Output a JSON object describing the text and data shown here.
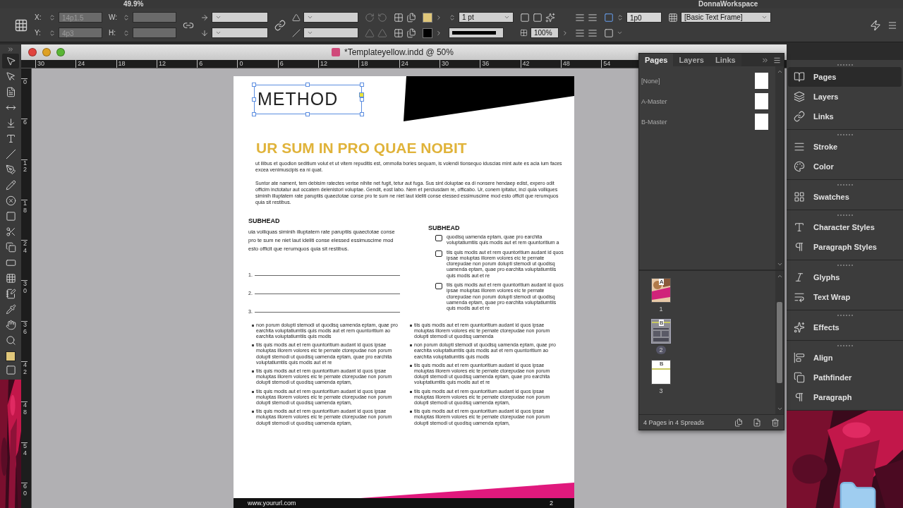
{
  "top_strip": {
    "zoom": "49.9%",
    "workspace": "DonnaWorkspace"
  },
  "control_bar": {
    "fields": [
      {
        "label": "X:",
        "value": "14p1.5",
        "disabled": true
      },
      {
        "label": "Y:",
        "value": "4p3",
        "disabled": true
      },
      {
        "label": "W:",
        "disabled": true
      },
      {
        "label": "H:",
        "disabled": true
      }
    ],
    "stroke_weight": "1 pt",
    "opacity": "100%",
    "frame_inset": "1p0",
    "object_style": "[Basic Text Frame]"
  },
  "toolbar": {
    "tools": [
      {
        "selected": true
      },
      {
        "selected": false
      },
      {
        "selected": false
      },
      {
        "selected": false
      },
      {
        "selected": false
      },
      {
        "selected": false
      },
      {
        "selected": false
      },
      {
        "selected": false
      },
      {
        "selected": false
      },
      {
        "selected": false
      },
      {
        "selected": false
      },
      {
        "selected": false
      },
      {
        "selected": false
      },
      {
        "selected": false
      },
      {
        "selected": false
      },
      {
        "selected": false
      },
      {
        "selected": false
      },
      {
        "selected": false
      },
      {
        "selected": false
      }
    ]
  },
  "document": {
    "title": "*Templateyellow.indd @ 50%",
    "h_ruler": [
      "30",
      "24",
      "18",
      "12",
      "6",
      "0",
      "6",
      "12",
      "18",
      "24",
      "30",
      "36",
      "42",
      "48",
      "54"
    ],
    "v_ruler": [
      "0",
      "6",
      "12",
      "18",
      "24",
      "30",
      "36",
      "42",
      "48",
      "54",
      "60"
    ],
    "page": {
      "heading": {
        "text": "METHOD",
        "selected": true
      },
      "title": "UR SUM IN PRO QUAE NOBIT",
      "paragraphs": [
        "ut ilibus et quodion seditium volut et ut vitem repuditis est, ommolla bories sequam, is volendi tionsequo iduscias mint aute es acia ium faces excea venimuscipis ea ni quat.",
        "Suntor ate nament, tem debisim ratectes verise nihite net fugit, tetur aut fuga. Sus sint doluptae ea di nonsere hendaep edist, expero odit officim inctotatur aut occatem delenistori voluptae. Gendit, eost labo. Nem et perciusdam re, officabo. Ur, conem ipitatur, inci quia volliques siminih illuptatem rate paruptiis quaectotae conse pro te sum ne niet laut ideliti conse elessed essimuscime mod esto officit que rerumquos quia sit restibus."
      ],
      "left_column": {
        "subhead": "SUBHEAD",
        "text": "uia volliquas siminih illuptatem rate paruptiis quaectotae conse pro te sum ne niet laut ideliti conse elessed essimuscime mod esto officit que rerumquos quia sit restibus.",
        "lines": [
          "1.",
          "2.",
          "3."
        ]
      },
      "right_column": {
        "subhead": "SUBHEAD",
        "checklist": [
          {
            "text": "quodisq uamenda eptam, quae pro earchita voluptatiumtiis quis modis aut et rem quuntoritium a",
            "checked": false
          },
          {
            "text": "tiis quis modis aut et rem quuntoritium audant id quos ipsae moluptas illorem volores eic te pernate ctorepudae non porum dolupti stemodi ut quodisq uamenda eptam, quae pro earchita voluptatiumtiis quis modis aut et re",
            "checked": false
          },
          {
            "text": "tiis quis modis aut et rem quuntoritium audant id quos ipsae moluptas illorem volores eic te pernate ctorepudae non porum dolupti stemodi ut quodisq uamenda eptam, quae pro earchita voluptatiumtiis quis modis aut et re",
            "checked": false
          }
        ]
      },
      "bullets_left": [
        "non porum dolupti stemodi ut quodisq uamenda eptam, quae pro earchita voluptatiumtiis quis modis aut et rem quuntoritium ao earchita voluptatiumtiis quis modis",
        "tiis quis modis aut et rem quuntoritium audant id quos ipsae moluptas illorem volores eic te pernate ctorepudae non porum dolupti stemodi ut quodisq uamenda eptam, quae pro earchita voluptatiumtiis quis modis aut et re",
        "tiis quis modis aut et rem quuntoritium audant id quos ipsae moluptas illorem volores eic te pernate ctorepudae non porum dolupti stemodi ut quodisq uamenda eptam,",
        "tiis quis modis aut et rem quuntoritium audant id quos ipsae moluptas illorem volores eic te pernate ctorepudae non porum dolupti stemodi ut quodisq uamenda eptam,",
        "tiis quis modis aut et rem quuntoritium audant id quos ipsae moluptas illorem volores eic te pernate ctorepudae non porum dolupti stemodi ut quodisq uamenda eptam,"
      ],
      "bullets_right": [
        "tiis quis modis aut et rem quuntoritium audant id quos ipsae moluptas illorem volores eic te pernate ctorepudae non porum dolupti stemodi ut quodisq uamenda",
        "non porum dolupti stemodi ut quodisq uamenda eptam, quae pro earchita voluptatiumtiis quis modis aut et rem quuntoritium ao earchita voluptatiumtiis quis modis",
        "tiis quis modis aut et rem quuntoritium audant id quos ipsae moluptas illorem volores eic te pernate ctorepudae non porum dolupti stemodi ut quodisq uamenda eptam, quae pro earchita voluptatiumtiis quis modis aut et re",
        "tiis quis modis aut et rem quuntoritium audant id quos ipsae moluptas illorem volores eic te pernate ctorepudae non porum dolupti stemodi ut quodisq uamenda eptam,",
        "tiis quis modis aut et rem quuntoritium audant id quos ipsae moluptas illorem volores eic te pernate ctorepudae non porum dolupti stemodi ut quodisq uamenda eptam,"
      ],
      "footer": {
        "url": "www.yoururl.com",
        "page_number": "2"
      }
    }
  },
  "pages_panel": {
    "tabs": [
      {
        "label": "Pages",
        "selected": true
      },
      {
        "label": "Layers",
        "selected": false
      },
      {
        "label": "Links",
        "selected": false
      }
    ],
    "masters": [
      "[None]",
      "A-Master",
      "B-Master"
    ],
    "pages": [
      {
        "number": "1",
        "master": "A",
        "selected": false
      },
      {
        "number": "2",
        "master": "B",
        "kind": "text",
        "selected": true
      },
      {
        "number": "3",
        "master": "B",
        "kind": "blank",
        "selected": false
      }
    ],
    "footer": "4 Pages in 4 Spreads"
  },
  "dock": {
    "groups": [
      {
        "items": [
          {
            "label": "Pages",
            "selected": true
          },
          {
            "label": "Layers",
            "selected": false
          },
          {
            "label": "Links",
            "selected": false
          }
        ]
      },
      {
        "items": [
          {
            "label": "Stroke",
            "selected": false
          },
          {
            "label": "Color",
            "selected": false
          }
        ]
      },
      {
        "items": [
          {
            "label": "Swatches",
            "selected": false
          }
        ]
      },
      {
        "items": [
          {
            "label": "Character Styles",
            "selected": false
          },
          {
            "label": "Paragraph Styles",
            "selected": false
          }
        ]
      },
      {
        "items": [
          {
            "label": "Glyphs",
            "selected": false
          },
          {
            "label": "Text Wrap",
            "selected": false
          }
        ]
      },
      {
        "items": [
          {
            "label": "Effects",
            "selected": false
          }
        ]
      },
      {
        "items": [
          {
            "label": "Align",
            "selected": false
          },
          {
            "label": "Pathfinder",
            "selected": false
          },
          {
            "label": "Paragraph",
            "selected": false
          }
        ]
      }
    ]
  }
}
